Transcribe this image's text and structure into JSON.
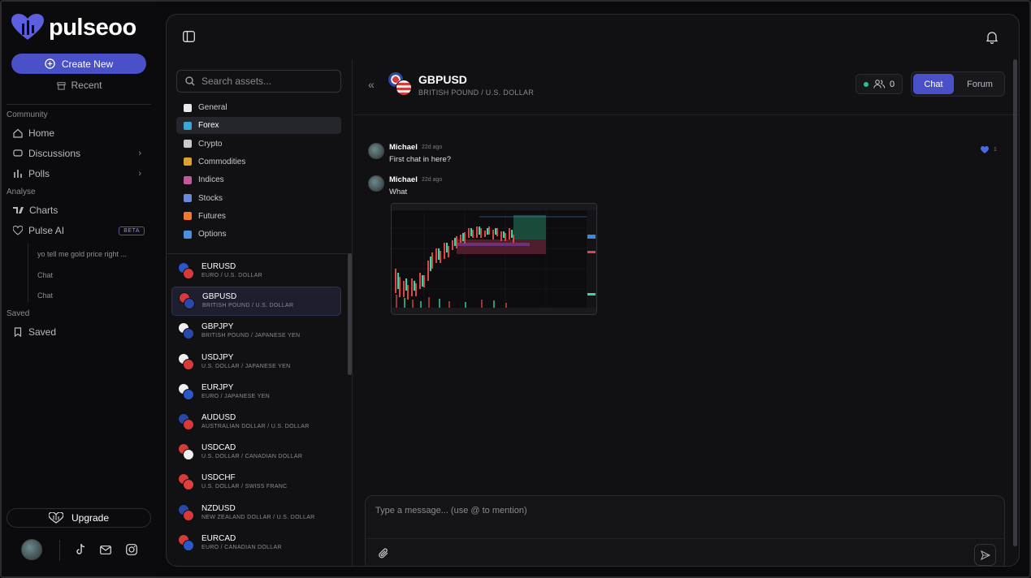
{
  "brand": {
    "name": "pulseoo",
    "accent": "#4a50c8"
  },
  "sidebar": {
    "create_label": "Create New",
    "recent_label": "Recent",
    "community_label": "Community",
    "analyse_label": "Analyse",
    "saved_section_label": "Saved",
    "nav": {
      "home": "Home",
      "discussions": "Discussions",
      "polls": "Polls",
      "charts": "Charts",
      "pulse_ai": "Pulse AI",
      "beta": "BETA",
      "saved": "Saved"
    },
    "ai_history": [
      "yo tell me gold price right ...",
      "Chat",
      "Chat"
    ],
    "upgrade_label": "Upgrade",
    "footer_icons": [
      "avatar",
      "tiktok-icon",
      "mail-icon",
      "instagram-icon"
    ]
  },
  "assets": {
    "search_placeholder": "Search assets...",
    "categories": [
      {
        "label": "General",
        "color": "#e9e9ee"
      },
      {
        "label": "Forex",
        "color": "#3aa6d8",
        "active": true
      },
      {
        "label": "Crypto",
        "color": "#c9c9cf"
      },
      {
        "label": "Commodities",
        "color": "#e0a030"
      },
      {
        "label": "Indices",
        "color": "#c05a9a"
      },
      {
        "label": "Stocks",
        "color": "#6a8ad8"
      },
      {
        "label": "Futures",
        "color": "#f07830"
      },
      {
        "label": "Options",
        "color": "#4a90e0"
      }
    ],
    "pairs": [
      {
        "symbol": "EURUSD",
        "name": "EURO / U.S. DOLLAR",
        "c1": "#2a58c8",
        "c2": "#d83a3a"
      },
      {
        "symbol": "GBPUSD",
        "name": "BRITISH POUND / U.S. DOLLAR",
        "c1": "#d83a3a",
        "c2": "#2a48a8",
        "active": true
      },
      {
        "symbol": "GBPJPY",
        "name": "BRITISH POUND / JAPANESE YEN",
        "c1": "#f0f0f0",
        "c2": "#2a48a8"
      },
      {
        "symbol": "USDJPY",
        "name": "U.S. DOLLAR / JAPANESE YEN",
        "c1": "#f0f0f0",
        "c2": "#d83a3a"
      },
      {
        "symbol": "EURJPY",
        "name": "EURO / JAPANESE YEN",
        "c1": "#f0f0f0",
        "c2": "#2a58c8"
      },
      {
        "symbol": "AUDUSD",
        "name": "AUSTRALIAN DOLLAR / U.S. DOLLAR",
        "c1": "#2a48a8",
        "c2": "#d83a3a"
      },
      {
        "symbol": "USDCAD",
        "name": "U.S. DOLLAR / CANADIAN DOLLAR",
        "c1": "#d83a3a",
        "c2": "#f0f0f0"
      },
      {
        "symbol": "USDCHF",
        "name": "U.S. DOLLAR / SWISS FRANC",
        "c1": "#d83a3a",
        "c2": "#e04040"
      },
      {
        "symbol": "NZDUSD",
        "name": "NEW ZEALAND DOLLAR / U.S. DOLLAR",
        "c1": "#2a48a8",
        "c2": "#d83a3a"
      },
      {
        "symbol": "EURCAD",
        "name": "EURO / CANADIAN DOLLAR",
        "c1": "#d83a3a",
        "c2": "#2a58c8"
      }
    ]
  },
  "chat": {
    "title": "GBPUSD",
    "subtitle": "BRITISH POUND / U.S. DOLLAR",
    "member_count": "0",
    "tab_chat": "Chat",
    "tab_forum": "Forum",
    "messages": [
      {
        "author": "Michael",
        "time": "22d ago",
        "text": "First chat in here?",
        "likes": "1"
      },
      {
        "author": "Michael",
        "time": "22d ago",
        "text": "What",
        "has_image": true
      }
    ],
    "compose_placeholder": "Type a message... (use @ to mention)"
  }
}
